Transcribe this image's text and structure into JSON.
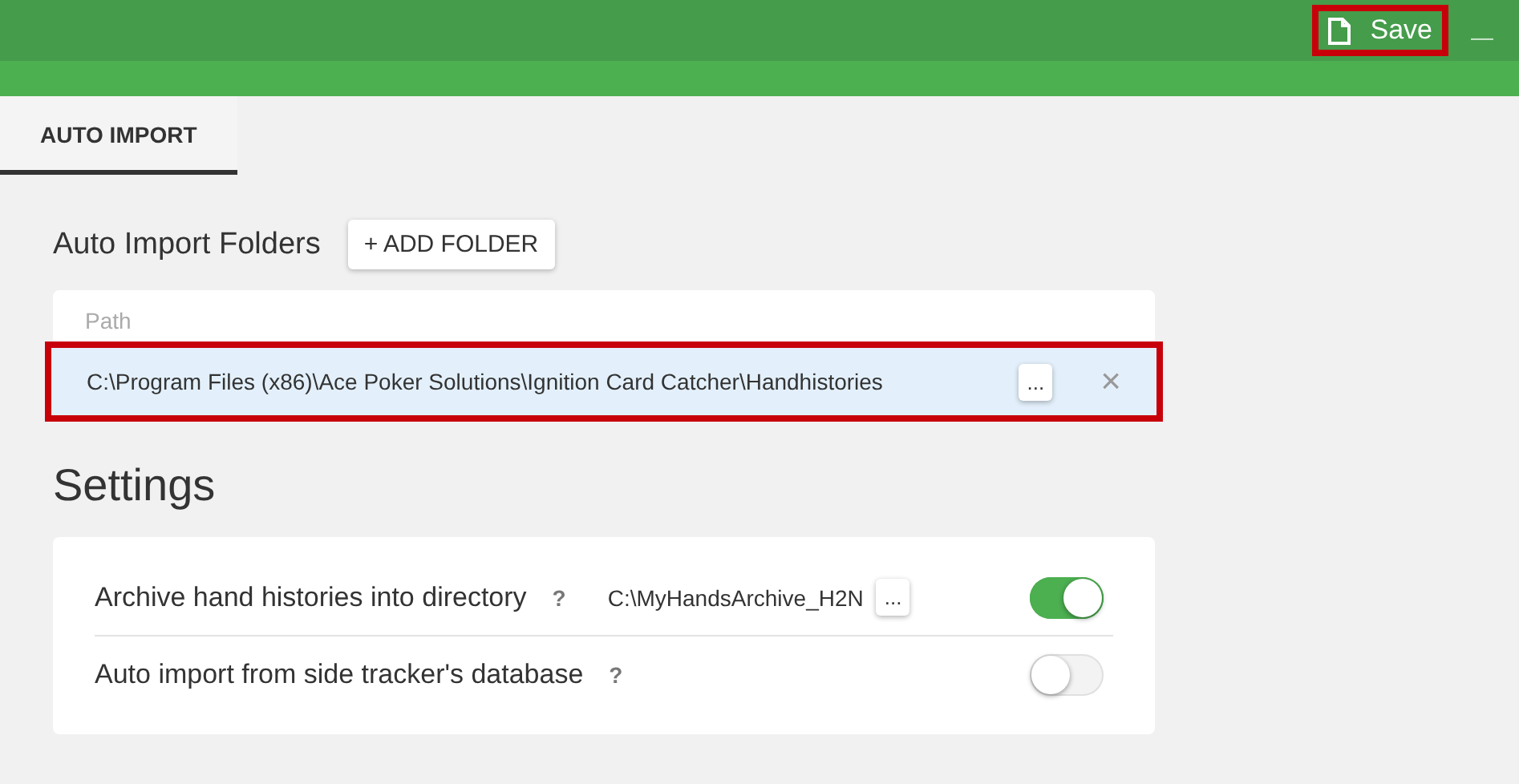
{
  "toolbar": {
    "save_label": "Save",
    "minimize_label": "—",
    "save_highlighted": true
  },
  "tabs": [
    {
      "label": "AUTO IMPORT",
      "selected": true
    }
  ],
  "auto_import": {
    "title": "Auto Import Folders",
    "add_button": "+ ADD FOLDER",
    "column": "Path",
    "folders": [
      {
        "path": "C:\\Program Files (x86)\\Ace Poker Solutions\\Ignition Card Catcher\\Handhistories",
        "browse": "...",
        "remove": "×",
        "selected": true,
        "highlighted": true
      }
    ]
  },
  "settings": {
    "title": "Settings",
    "rows": [
      {
        "label": "Archive hand histories into directory",
        "help": "?",
        "path": "C:\\MyHandsArchive_H2N",
        "browse": "...",
        "on": true
      },
      {
        "label": "Auto import from side tracker's database",
        "help": "?",
        "on": false
      }
    ]
  }
}
